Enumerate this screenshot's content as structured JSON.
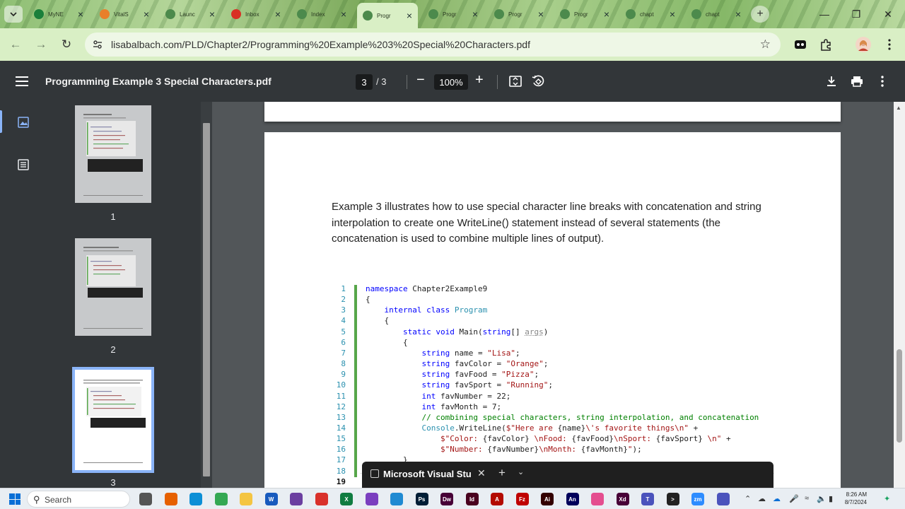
{
  "browser": {
    "tabs": [
      {
        "label": "MyNE",
        "color": "#1b7f3b"
      },
      {
        "label": "VitalS",
        "color": "#e8802a"
      },
      {
        "label": "Launc",
        "color": "#4c8a4c"
      },
      {
        "label": "Inbox",
        "color": "#d93025"
      },
      {
        "label": "Index",
        "color": "#4c8a4c"
      },
      {
        "label": "Progr",
        "color": "#4c8a4c",
        "active": true
      },
      {
        "label": "Progr",
        "color": "#4c8a4c"
      },
      {
        "label": "Progr",
        "color": "#4c8a4c"
      },
      {
        "label": "Progr",
        "color": "#4c8a4c"
      },
      {
        "label": "chapt",
        "color": "#4c8a4c"
      },
      {
        "label": "chapt",
        "color": "#4c8a4c"
      }
    ],
    "url": "lisabalbach.com/PLD/Chapter2/Programming%20Example%203%20Special%20Characters.pdf"
  },
  "pdf": {
    "title": "Programming Example 3 Special Characters.pdf",
    "current_page": "3",
    "page_total": "/ 3",
    "zoom": "100%",
    "thumbnails": [
      {
        "num": "1"
      },
      {
        "num": "2"
      },
      {
        "num": "3"
      }
    ]
  },
  "document": {
    "paragraph": "Example 3 illustrates how to use special character line breaks with concatenation and string interpolation to create one WriteLine() statement instead of several statements  (the concatenation is used to combine multiple lines of output).",
    "code_lines": [
      {
        "n": "1",
        "text": "namespace Chapter2Example9"
      },
      {
        "n": "2",
        "text": "{"
      },
      {
        "n": "3",
        "text": "    internal class Program"
      },
      {
        "n": "4",
        "text": "    {"
      },
      {
        "n": "5",
        "text": "        static void Main(string[] args)"
      },
      {
        "n": "6",
        "text": "        {"
      },
      {
        "n": "7",
        "text": "            string name = \"Lisa\";"
      },
      {
        "n": "8",
        "text": "            string favColor = \"Orange\";"
      },
      {
        "n": "9",
        "text": "            string favFood = \"Pizza\";"
      },
      {
        "n": "10",
        "text": "            string favSport = \"Running\";"
      },
      {
        "n": "11",
        "text": "            int favNumber = 22;"
      },
      {
        "n": "12",
        "text": "            int favMonth = 7;"
      },
      {
        "n": "13",
        "text": "            // combining special characters, string interpolation, and concatenation"
      },
      {
        "n": "14",
        "text": "            Console.WriteLine($\"Here are {name}\\'s favorite things\\n\" +"
      },
      {
        "n": "15",
        "text": "                $\"Color: {favColor} \\nFood: {favFood}\\nSport: {favSport} \\n\" +"
      },
      {
        "n": "16",
        "text": "                $\"Number: {favNumber}\\nMonth: {favMonth}\");"
      },
      {
        "n": "17",
        "text": "        }"
      },
      {
        "n": "18",
        "text": "    }"
      },
      {
        "n": "19",
        "text": "}"
      }
    ]
  },
  "vs_popup": {
    "label": "Microsoft Visual Stu"
  },
  "taskbar": {
    "search": "Search",
    "time": "8:26 AM",
    "date": "8/7/2024"
  },
  "colors": {
    "pdf_toolbar": "#323639",
    "chrome_frame": "#d9efc5",
    "accent": "#8ab4f8"
  }
}
